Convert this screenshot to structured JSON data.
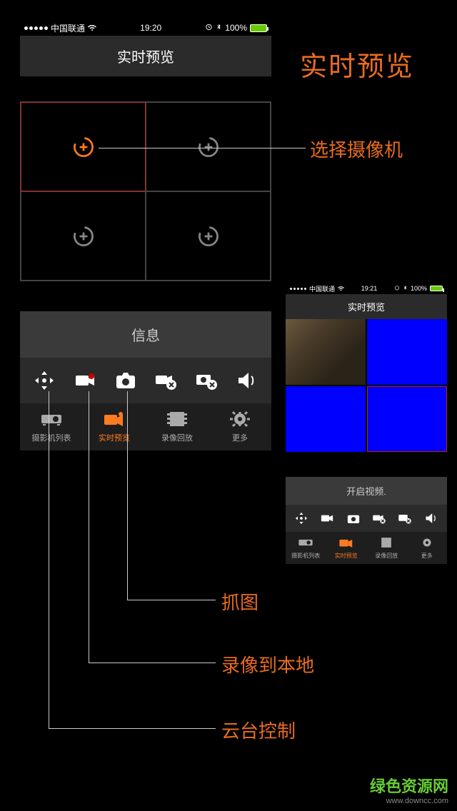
{
  "status": {
    "carrier": "中国联通",
    "time": "19:20",
    "battery": "100%"
  },
  "header": {
    "title": "实时预览"
  },
  "annotations": {
    "title": "实时预览",
    "select_camera": "选择摄像机",
    "capture": "抓图",
    "record_local": "录像到本地",
    "ptz": "云台控制"
  },
  "panel": {
    "title": "信息",
    "tabs": {
      "camera_list": "摄影机列表",
      "live_preview": "实时预览",
      "playback": "录像回放",
      "more": "更多"
    }
  },
  "small": {
    "status": {
      "carrier": "中国联通",
      "time": "19:21",
      "battery": "100%"
    },
    "header": {
      "title": "实时预览"
    },
    "panel_title": "开启视频.",
    "tabs": {
      "camera_list": "摄影机列表",
      "live_preview": "实时预览",
      "playback": "录像回放",
      "more": "更多"
    }
  },
  "watermark": {
    "line1": "绿色资源网",
    "line2": "www.downcc.com"
  }
}
